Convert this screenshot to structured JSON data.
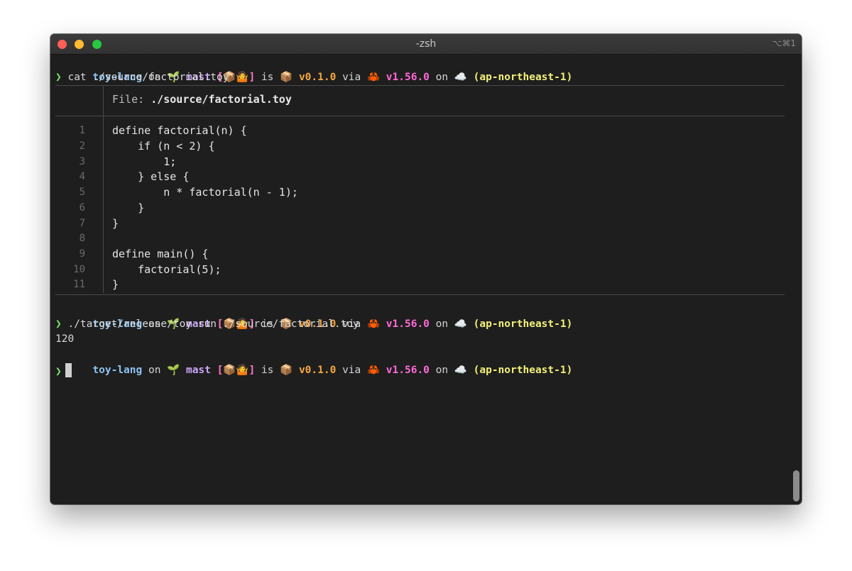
{
  "window": {
    "title": "-zsh",
    "shortcut": "⌥⌘1"
  },
  "prompt": {
    "dir": "toy-lang",
    "on1": "on",
    "branch_icon": "🌱",
    "branch": "mast",
    "status": "[📦🤷]",
    "is": "is",
    "pkg_icon": "📦",
    "pkg_version": "v0.1.0",
    "via": "via",
    "rust_icon": "🦀",
    "rust_version": "v1.56.0",
    "on2": "on",
    "cloud_icon": "☁️",
    "aws_region": "(ap-northeast-1)",
    "chevron": "❯"
  },
  "commands": [
    "cat ./source/factorial.toy",
    "./target/release/toy run ./source/factorial.toy"
  ],
  "bat": {
    "file_label": "File: ",
    "file_path": "./source/factorial.toy",
    "lines": [
      {
        "n": "1",
        "code": "define factorial(n) {"
      },
      {
        "n": "2",
        "code": "    if (n < 2) {"
      },
      {
        "n": "3",
        "code": "        1;"
      },
      {
        "n": "4",
        "code": "    } else {"
      },
      {
        "n": "5",
        "code": "        n * factorial(n - 1);"
      },
      {
        "n": "6",
        "code": "    }"
      },
      {
        "n": "7",
        "code": "}"
      },
      {
        "n": "8",
        "code": ""
      },
      {
        "n": "9",
        "code": "define main() {"
      },
      {
        "n": "10",
        "code": "    factorial(5);"
      },
      {
        "n": "11",
        "code": "}"
      }
    ]
  },
  "output": "120"
}
